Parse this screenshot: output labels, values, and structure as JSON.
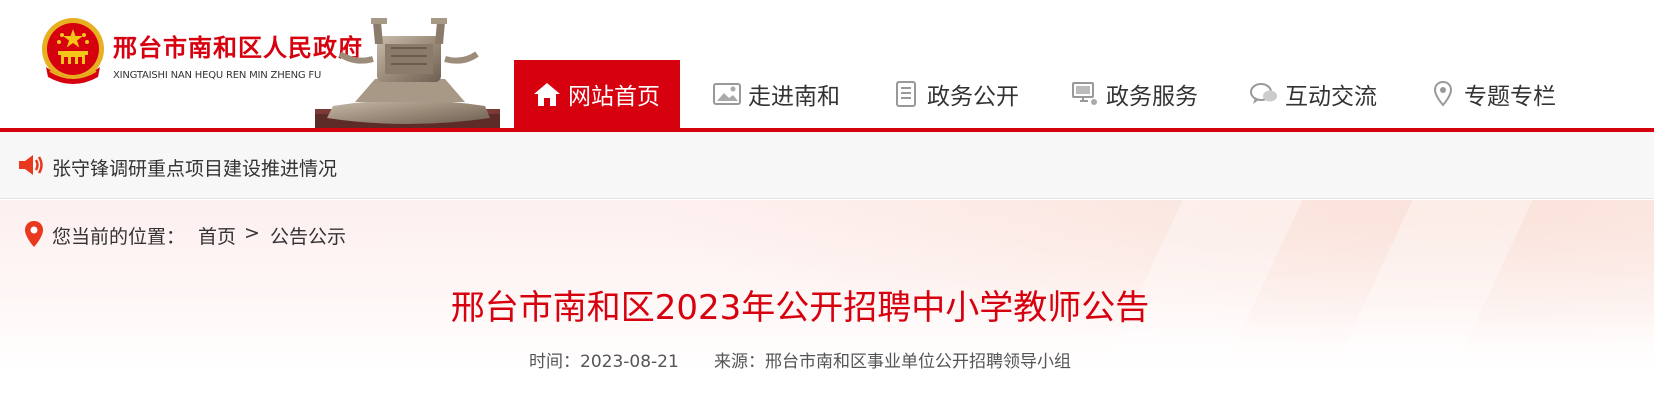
{
  "site": {
    "title": "邢台市南和区人民政府",
    "pinyin": "XINGTAISHI NAN HEQU REN MIN ZHENG FU"
  },
  "nav": {
    "items": [
      {
        "label": "网站首页",
        "icon": "home-icon",
        "active": true
      },
      {
        "label": "走进南和",
        "icon": "picture-icon",
        "active": false
      },
      {
        "label": "政务公开",
        "icon": "document-icon",
        "active": false
      },
      {
        "label": "政务服务",
        "icon": "computer-icon",
        "active": false
      },
      {
        "label": "互动交流",
        "icon": "chat-icon",
        "active": false
      },
      {
        "label": "专题专栏",
        "icon": "location-icon",
        "active": false
      }
    ]
  },
  "ticker": {
    "icon": "speaker-icon",
    "text": "张守锋调研重点项目建设推进情况"
  },
  "breadcrumb": {
    "label": "您当前的位置：",
    "home": "首页",
    "separator": ">",
    "current": "公告公示"
  },
  "article": {
    "title": "邢台市南和区2023年公开招聘中小学教师公告",
    "time": "时间：2023-08-21",
    "source": "来源：邢台市南和区事业单位公开招聘领导小组"
  },
  "colors": {
    "brand_red": "#d7000f",
    "ticker_bg": "#f7f7f7"
  }
}
